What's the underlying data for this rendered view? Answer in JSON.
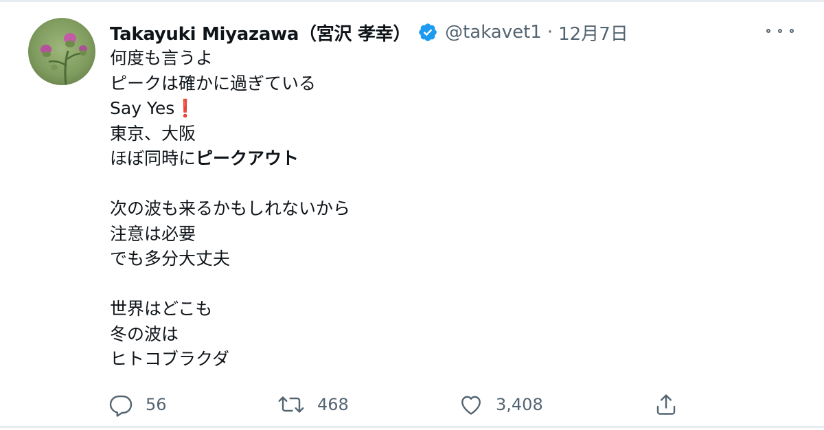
{
  "tweet": {
    "author": {
      "display_name": "Takayuki Miyazawa（宮沢 孝幸）",
      "handle": "@takavet1",
      "verified": true,
      "avatar_icon": "thistle-flower-photo"
    },
    "separator": "·",
    "date": "12月7日",
    "body": {
      "line1": "何度も言うよ",
      "line2": "ピークは確かに過ぎている",
      "line3_text": "Say Yes",
      "line3_emoji": "❗",
      "line4": "東京、大阪",
      "line5_text": "ほぼ同時に",
      "line5_bold": "ピークアウト",
      "line6": "次の波も来るかもしれないから",
      "line7": "注意は必要",
      "line8": "でも多分大丈夫",
      "line9": "世界はどこも",
      "line10": "冬の波は",
      "line11": "ヒトコブラクダ"
    },
    "actions": {
      "reply_count": "56",
      "retweet_count": "468",
      "like_count": "3,408"
    }
  },
  "colors": {
    "text": "#0f1419",
    "secondary": "#536471",
    "verified": "#1d9bf0",
    "exclamation": "#d62b3a",
    "border": "#e6ecf0"
  }
}
